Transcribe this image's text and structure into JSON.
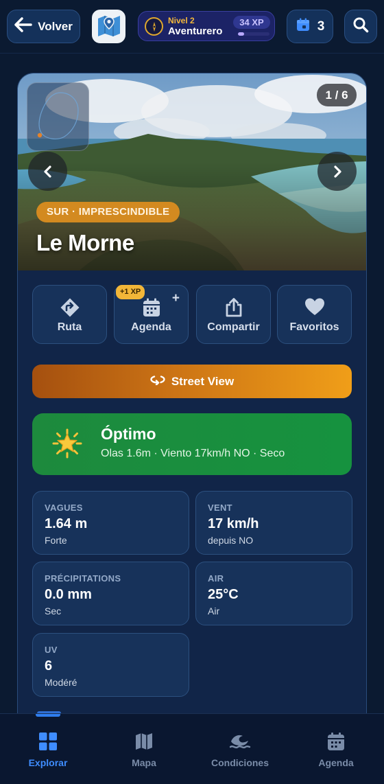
{
  "topbar": {
    "back_label": "Volver",
    "level_label": "Nivel 2",
    "level_name": "Aventurero",
    "xp_label": "34 XP",
    "xp_progress": 0.2,
    "agenda_count": "3"
  },
  "hero": {
    "image_counter": "1 / 6",
    "region_tag": "SUR · IMPRESCINDIBLE",
    "place_name": "Le Morne"
  },
  "actions": [
    {
      "label": "Ruta",
      "icon": "directions-icon"
    },
    {
      "label": "Agenda",
      "icon": "calendar-add-icon",
      "badge": "+1 XP",
      "plus": "+"
    },
    {
      "label": "Compartir",
      "icon": "share-icon"
    },
    {
      "label": "Favoritos",
      "icon": "heart-icon"
    }
  ],
  "street_view": {
    "label": "Street View",
    "icon": "street-view-icon"
  },
  "conditions": {
    "title": "Óptimo",
    "summary": "Olas 1.6m · Viento 17km/h NO · Seco",
    "icon": "sun-icon"
  },
  "weather": [
    {
      "label": "VAGUES",
      "value": "1.64 m",
      "sub": "Forte"
    },
    {
      "label": "VENT",
      "value": "17 km/h",
      "sub": "depuis NO"
    },
    {
      "label": "PRÉCIPITATIONS",
      "value": "0.0 mm",
      "sub": "Sec"
    },
    {
      "label": "AIR",
      "value": "25°C",
      "sub": "Air"
    },
    {
      "label": "UV",
      "value": "6",
      "sub": "Modéré"
    }
  ],
  "bottom_nav": [
    {
      "label": "Explorar",
      "icon": "grid-icon",
      "active": true
    },
    {
      "label": "Mapa",
      "icon": "map-icon",
      "active": false
    },
    {
      "label": "Condiciones",
      "icon": "waves-icon",
      "active": false
    },
    {
      "label": "Agenda",
      "icon": "calendar-icon",
      "active": false
    }
  ],
  "colors": {
    "background": "#0b1a31",
    "accent_orange": "#f09e18",
    "optimal_green": "#1d8a3d",
    "active_blue": "#3f8dff"
  }
}
